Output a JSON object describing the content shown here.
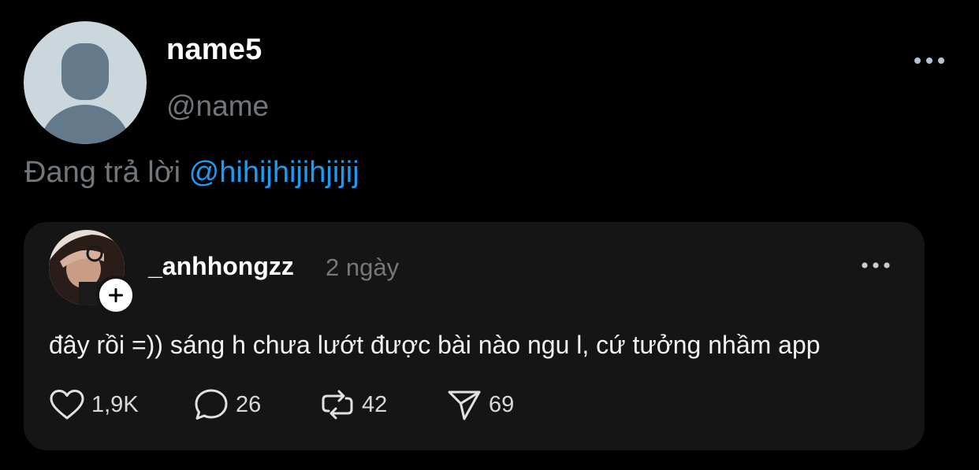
{
  "post": {
    "display_name": "name5",
    "handle": "@name",
    "reply_prefix": "Đang trả lời",
    "reply_mention": "@hihijhijihjijij",
    "menu_icon": "more-horizontal-icon"
  },
  "quoted": {
    "username": "_anhhongzz",
    "time": "2 ngày",
    "text": "đây rồi =)) sáng h chưa lướt được bài nào ngu l, cứ tưởng nhầm app",
    "follow_icon": "plus-icon",
    "menu_icon": "more-horizontal-icon",
    "actions": {
      "likes": {
        "icon": "heart-icon",
        "count": "1,9K"
      },
      "replies": {
        "icon": "comment-bubble-icon",
        "count": "26"
      },
      "reposts": {
        "icon": "repost-icon",
        "count": "42"
      },
      "shares": {
        "icon": "send-icon",
        "count": "69"
      }
    }
  },
  "colors": {
    "background": "#000000",
    "card_background": "#151515",
    "mention": "#1d9bf0",
    "muted": "#71767b",
    "default_avatar": "#ccd6dd"
  }
}
